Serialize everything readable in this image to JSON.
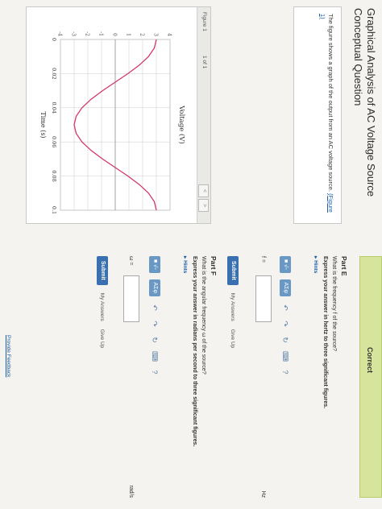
{
  "title": {
    "line1": "Graphical Analysis of AC Voltage Source",
    "line2": "Conceptual Question"
  },
  "problem": {
    "text": "The figure shows a graph of the output from an AC voltage source.",
    "figure_link": "(Figure 1)"
  },
  "figure": {
    "label": "Figure 1",
    "nav": "1 of 1",
    "prev": "<",
    "next": ">"
  },
  "chart_data": {
    "type": "line",
    "ylabel": "Voltage (V)",
    "xlabel": "Time (s)",
    "xlim": [
      0,
      0.1
    ],
    "ylim": [
      -4,
      4
    ],
    "x_ticks": [
      "0",
      "0.02",
      "0.04",
      "0.06",
      "0.08",
      "0.1"
    ],
    "y_ticks": [
      "4",
      "3",
      "2",
      "1",
      "0",
      "-1",
      "-2",
      "-3",
      "-4"
    ],
    "grid": true,
    "series": [
      {
        "color": "#d2376a",
        "x": [
          0,
          0.005,
          0.01,
          0.015,
          0.02,
          0.025,
          0.03,
          0.035,
          0.04,
          0.045,
          0.05,
          0.055,
          0.06,
          0.065,
          0.07,
          0.075,
          0.08,
          0.085,
          0.09,
          0.095,
          0.1
        ],
        "y": [
          3.0,
          2.853,
          2.427,
          1.763,
          0.927,
          0.0,
          -0.927,
          -1.763,
          -2.427,
          -2.853,
          -3.0,
          -2.853,
          -2.427,
          -1.763,
          -0.927,
          0.0,
          0.927,
          1.763,
          2.427,
          2.853,
          3.0
        ]
      }
    ]
  },
  "status": {
    "banner": "Correct"
  },
  "part_e": {
    "title": "Part E",
    "question": "What is the frequency f of the source?",
    "instruction": "Express your answer in hertz to three significant figures.",
    "hints": "Hints",
    "answer_label": "f =",
    "unit": "Hz",
    "submit": "Submit",
    "my_answers": "My Answers",
    "give_up": "Give Up"
  },
  "part_f": {
    "title": "Part F",
    "question": "What is the angular frequency ω of the source?",
    "instruction": "Express your answer in radians per second to three significant figures.",
    "hints": "Hints",
    "answer_label": "ω =",
    "unit": "rad/s",
    "submit": "Submit",
    "my_answers": "My Answers",
    "give_up": "Give Up"
  },
  "toolbar": {
    "template_label": "■ √▫",
    "symbols_label": "ΑΣφ",
    "undo_icon": "↶",
    "redo_icon": "↷",
    "reset_icon": "↻",
    "keyboard_icon": "⌨",
    "help_icon": "?"
  },
  "footer": {
    "feedback": "Provide Feedback"
  },
  "colors": {
    "banner": "#d7e59c",
    "link": "#1a5da8",
    "submit": "#3a6fb0",
    "toolbar_button": "#6a98c4",
    "curve": "#d2376a"
  }
}
